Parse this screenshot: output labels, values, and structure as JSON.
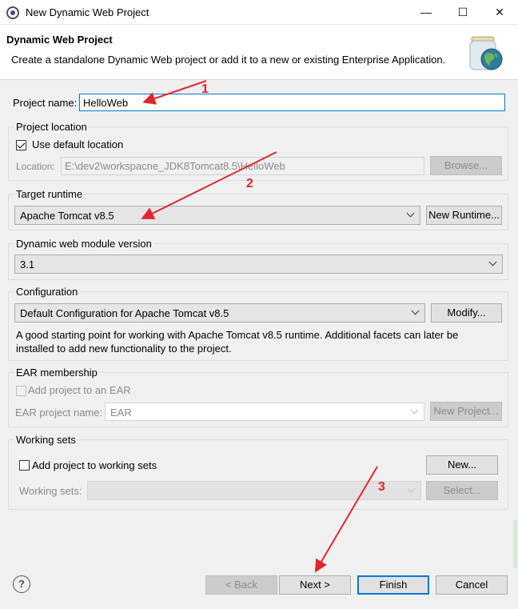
{
  "window": {
    "title": "New Dynamic Web Project",
    "minimize_glyph": "—",
    "maximize_glyph": "☐",
    "close_glyph": "✕"
  },
  "header": {
    "title": "Dynamic Web Project",
    "description": "Create a standalone Dynamic Web project or add it to a new or existing Enterprise Application."
  },
  "project_name": {
    "label": "Project name:",
    "value": "HelloWeb"
  },
  "project_location": {
    "group_title": "Project location",
    "use_default_label": "Use default location",
    "use_default_checked": true,
    "location_label": "Location:",
    "location_value": "E:\\dev2\\workspacne_JDK8Tomcat8.5\\HelloWeb",
    "browse_label": "Browse..."
  },
  "target_runtime": {
    "group_title": "Target runtime",
    "selected": "Apache Tomcat v8.5",
    "new_runtime_label": "New Runtime..."
  },
  "module_version": {
    "group_title": "Dynamic web module version",
    "selected": "3.1"
  },
  "configuration": {
    "group_title": "Configuration",
    "selected": "Default Configuration for Apache Tomcat v8.5",
    "modify_label": "Modify...",
    "description_line1": "A good starting point for working with Apache Tomcat v8.5 runtime. Additional facets can later be",
    "description_line2": "installed to add new functionality to the project."
  },
  "ear": {
    "group_title": "EAR membership",
    "add_label": "Add project to an EAR",
    "add_checked": false,
    "project_name_label": "EAR project name:",
    "project_name_value": "EAR",
    "new_project_label": "New Project..."
  },
  "working_sets": {
    "group_title": "Working sets",
    "add_label": "Add project to working sets",
    "add_checked": false,
    "new_label": "New...",
    "sets_label": "Working sets:",
    "select_label": "Select..."
  },
  "footer": {
    "help_glyph": "?",
    "back_label": "< Back",
    "next_label": "Next >",
    "finish_label": "Finish",
    "cancel_label": "Cancel"
  },
  "annotations": {
    "marker1": "1",
    "marker2": "2",
    "marker3": "3",
    "color": "#e0262b"
  },
  "colors": {
    "focus_accent": "#0078d7",
    "dialog_background": "#f0f0f0"
  }
}
